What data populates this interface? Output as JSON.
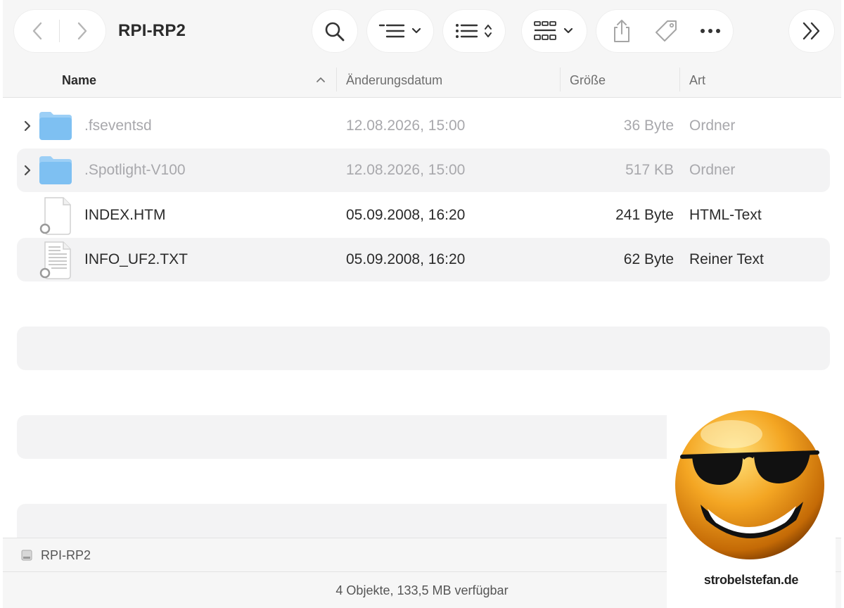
{
  "toolbar": {
    "title": "RPI-RP2",
    "back_icon": "chevron-left-icon",
    "forward_icon": "chevron-right-icon",
    "search_icon": "search-icon",
    "group_icon": "group-by-icon",
    "sort_icon": "sort-options-icon",
    "view_icon": "gallery-view-icon",
    "share_icon": "share-icon",
    "tag_icon": "tag-icon",
    "more_icon": "ellipsis-icon",
    "overflow_icon": "double-chevron-right-icon"
  },
  "columns": {
    "name": "Name",
    "date": "Änderungsdatum",
    "size": "Größe",
    "kind": "Art"
  },
  "files": [
    {
      "name": ".fseventsd",
      "date": "12.08.2026, 15:00",
      "size": "36 Byte",
      "kind": "Ordner",
      "icon": "folder-icon"
    },
    {
      "name": ".Spotlight-V100",
      "date": "12.08.2026, 15:00",
      "size": "517 KB",
      "kind": "Ordner",
      "icon": "folder-icon"
    },
    {
      "name": "INDEX.HTM",
      "date": "05.09.2008, 16:20",
      "size": "241 Byte",
      "kind": "HTML-Text",
      "icon": "html-document-icon"
    },
    {
      "name": "INFO_UF2.TXT",
      "date": "05.09.2008, 16:20",
      "size": "62 Byte",
      "kind": "Reiner Text",
      "icon": "text-document-icon"
    }
  ],
  "pathbar": {
    "label": "RPI-RP2",
    "icon": "drive-icon"
  },
  "status": "4 Objekte, 133,5 MB verfügbar",
  "watermark": {
    "text": "strobelstefan.de",
    "icon": "sunglasses-smiley-icon"
  },
  "colors": {
    "folder": "#7ec0f2",
    "accent": "#1d1d1f",
    "stripe": "#f3f3f4"
  }
}
